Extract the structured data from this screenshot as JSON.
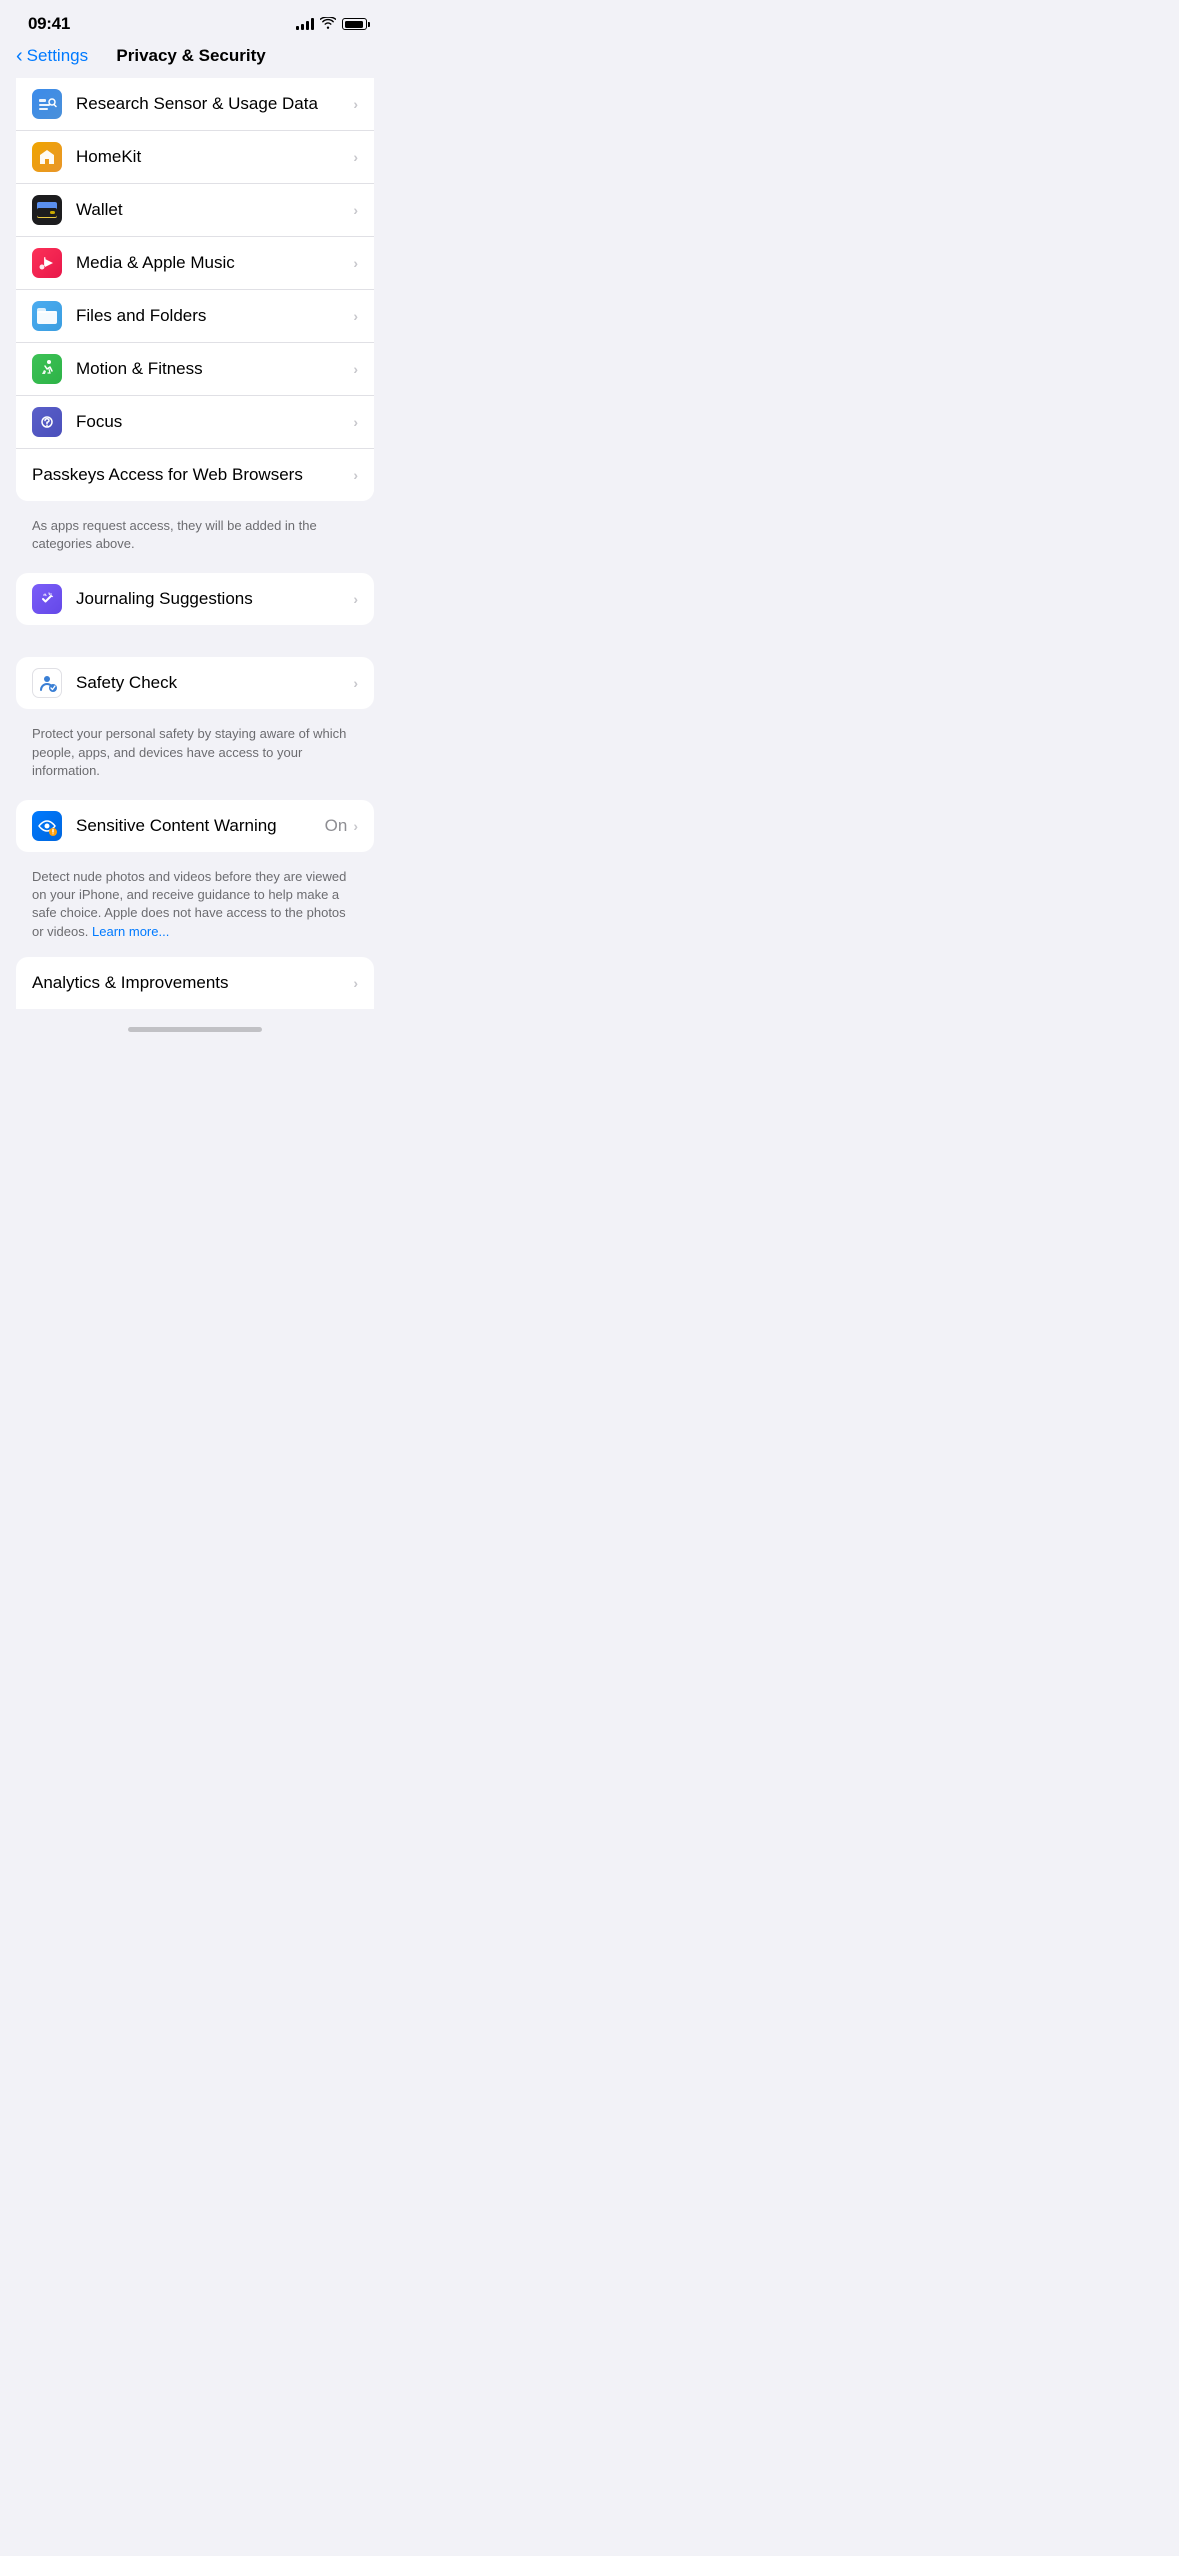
{
  "statusBar": {
    "time": "09:41",
    "signal": 4,
    "wifi": true,
    "battery": 100
  },
  "nav": {
    "backLabel": "Settings",
    "title": "Privacy & Security"
  },
  "topSection": {
    "items": [
      {
        "id": "research",
        "icon": "research-icon",
        "iconBg": "icon-research",
        "label": "Research Sensor & Usage Data",
        "value": ""
      },
      {
        "id": "homekit",
        "icon": "homekit-icon",
        "iconBg": "icon-homekit",
        "label": "HomeKit",
        "value": ""
      },
      {
        "id": "wallet",
        "icon": "wallet-icon",
        "iconBg": "icon-wallet",
        "label": "Wallet",
        "value": ""
      },
      {
        "id": "media",
        "icon": "media-icon",
        "iconBg": "icon-media",
        "label": "Media & Apple Music",
        "value": ""
      },
      {
        "id": "files",
        "icon": "files-icon",
        "iconBg": "icon-files",
        "label": "Files and Folders",
        "value": ""
      },
      {
        "id": "motion",
        "icon": "motion-icon",
        "iconBg": "icon-motion",
        "label": "Motion & Fitness",
        "value": ""
      },
      {
        "id": "focus",
        "icon": "focus-icon",
        "iconBg": "icon-focus",
        "label": "Focus",
        "value": ""
      }
    ],
    "passkeysItem": {
      "label": "Passkeys Access for Web Browsers"
    },
    "footer": "As apps request access, they will be added in the categories above."
  },
  "journalingSection": {
    "item": {
      "id": "journaling",
      "icon": "journaling-icon",
      "iconBg": "icon-journaling",
      "label": "Journaling Suggestions",
      "value": ""
    }
  },
  "safetySection": {
    "item": {
      "id": "safety",
      "icon": "safety-icon",
      "iconBg": "icon-safety",
      "label": "Safety Check",
      "value": ""
    },
    "footer": "Protect your personal safety by staying aware of which people, apps, and devices have access to your information."
  },
  "sensitiveSection": {
    "item": {
      "id": "sensitive",
      "icon": "sensitive-icon",
      "iconBg": "icon-sensitive",
      "label": "Sensitive Content Warning",
      "value": "On"
    },
    "footer": "Detect nude photos and videos before they are viewed on your iPhone, and receive guidance to help make a safe choice. Apple does not have access to the photos or videos.",
    "learnMore": "Learn more..."
  },
  "analyticsPartial": {
    "label": "Analytics & Improvements"
  },
  "homeIndicator": {}
}
